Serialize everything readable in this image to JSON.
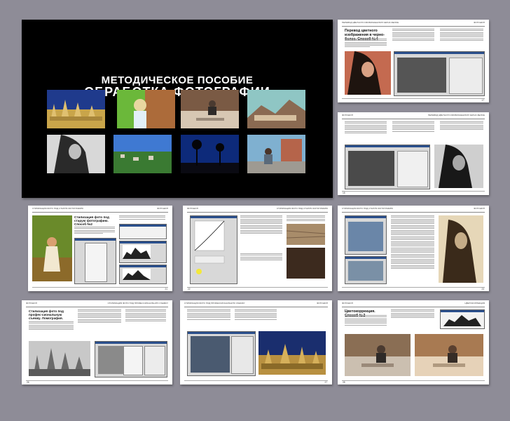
{
  "cover": {
    "title_line1": "МЕТОДИЧЕСКОЕ ПОСОБИЕ",
    "title_line2": "ОБРАБОТКА ФОТОГРАФИИ"
  },
  "pages": [
    {
      "id": "p1",
      "header_left": "ПЕРЕВОД ЦВЕТНОГО ИЗОБРАЖЕНИЯ В ЧЕРНО-БЕЛОЕ",
      "header_right": "ФОТОШОП",
      "title": "Перевод цветного изображения в черно-белое. Способ №4",
      "number": "17"
    },
    {
      "id": "p2",
      "header_left": "ФОТОШОП",
      "header_right": "ПЕРЕВОД ЦВЕТНОГО ИЗОБРАЖЕНИЯ В ЧЕРНО-БЕЛОЕ",
      "title": "",
      "number": "18"
    },
    {
      "id": "p3",
      "header_left": "СТИЛИЗАЦИЯ ФОТО ПОД СТАРУЮ ФОТОГРАФИЮ",
      "header_right": "ФОТОШОП",
      "title": "Стилизация фото под старую фотографию. Способ №2",
      "number": "21"
    },
    {
      "id": "p4",
      "header_left": "ФОТОШОП",
      "header_right": "СТИЛИЗАЦИЯ ФОТО ПОД СТАРУЮ ФОТОГРАФИЮ",
      "title": "",
      "number": "22"
    },
    {
      "id": "p5",
      "header_left": "СТИЛИЗАЦИЯ ФОТО ПОД СТАРУЮ ФОТОГРАФИЮ",
      "header_right": "ФОТОШОП",
      "title": "",
      "number": "23"
    },
    {
      "id": "p6",
      "header_left": "ФОТОШОП",
      "header_right": "СТИЛИЗАЦИЯ ФОТО ПОД ПРОФЕССИОНАЛЬНУЮ СЪЕМКУ",
      "title": "Стилизация фото под профес-сиональную съемку. Ломография.",
      "number": "26"
    },
    {
      "id": "p7",
      "header_left": "СТИЛИЗАЦИЯ ФОТО ПОД ПРОФЕССИОНАЛЬНУЮ СЪЕМКУ",
      "header_right": "ФОТОШОП",
      "title": "",
      "number": "27"
    },
    {
      "id": "p8",
      "header_left": "ФОТОШОП",
      "header_right": "ЦВЕТОКОРРЕКЦИЯ",
      "title": "Цветокоррекция. Способ №3",
      "number": "28"
    }
  ]
}
